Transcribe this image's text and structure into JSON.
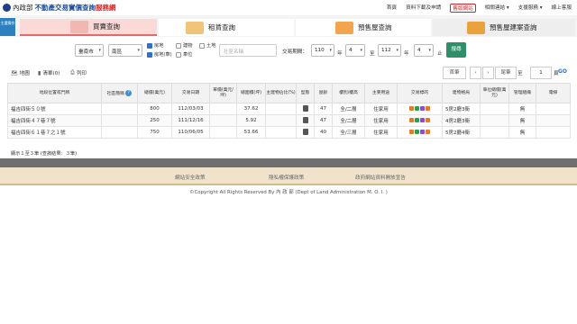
{
  "header": {
    "ministry": "內政部",
    "site_title": "不動產交易實價查詢",
    "site_title_suffix": "服務網",
    "nav": [
      "首頁",
      "資料下載及申請",
      "舊版網站",
      "相關連結 ▾",
      "支援服務 ▾",
      "線上客服"
    ]
  },
  "side_button": "主選操作",
  "tabs": [
    "買賣查詢",
    "租賃查詢",
    "預售屋查詢",
    "預售屋建案查詢"
  ],
  "filters": {
    "city": "臺南市",
    "district": "南區",
    "types": [
      {
        "label": "房地",
        "checked": true
      },
      {
        "label": "建物",
        "checked": false
      },
      {
        "label": "土地",
        "checked": false
      },
      {
        "label": "房地(車)",
        "checked": true
      },
      {
        "label": "車位",
        "checked": false
      }
    ],
    "keyword_placeholder": "社區名稱",
    "period_label": "交易期間：",
    "from_year": "110",
    "year_unit": "年",
    "from_month": "4",
    "to_label": "至",
    "to_year": "112",
    "to_month": "4",
    "until": "止",
    "search_button": "搜尋"
  },
  "toolbar": {
    "map": "地圖",
    "list": "清單(0)",
    "print": "列印",
    "first": "首筆",
    "prev": "‹",
    "next": "›",
    "last": "尾筆",
    "page_prefix": "至",
    "page_value": "1",
    "page_suffix": "頁",
    "go": "GO"
  },
  "table": {
    "headers": [
      "地段位置或門牌",
      "社區簡稱",
      "總價(萬元)",
      "交易日期",
      "單價(萬元/坪)",
      "總面積(坪)",
      "主建物佔比(%)",
      "型態",
      "屋齡",
      "樓別/樓高",
      "主要用途",
      "交易標的",
      "建物格局",
      "車位總價(萬元)",
      "管理組織",
      "電梯"
    ],
    "rows": [
      {
        "address": "福吉四街５０號",
        "community": "",
        "price": "800",
        "date": "112/03/03",
        "unit": "",
        "area": "37.62",
        "ratio": "",
        "age": "47",
        "floor": "全/二層",
        "use": "住家用",
        "layout": "5房2廳3衛",
        "parking": "",
        "mgmt": "無",
        "elev": ""
      },
      {
        "address": "福吉四街４７巷７號",
        "community": "",
        "price": "250",
        "date": "111/12/16",
        "unit": "",
        "area": "5.92",
        "ratio": "",
        "age": "47",
        "floor": "全/二層",
        "use": "住家用",
        "layout": "4房2廳3衛",
        "parking": "",
        "mgmt": "無",
        "elev": ""
      },
      {
        "address": "福吉四街６１巷７之１號",
        "community": "",
        "price": "750",
        "date": "110/06/05",
        "unit": "",
        "area": "53.66",
        "ratio": "",
        "age": "40",
        "floor": "全/三層",
        "use": "住家用",
        "layout": "5房2廳4衛",
        "parking": "",
        "mgmt": "無",
        "elev": ""
      }
    ]
  },
  "summary": "顯示１至３筆 (查詢結果：３筆)",
  "footer": {
    "links": [
      "網站安全政策",
      "隱私權保護政策",
      "政府網站資料開放宣告"
    ],
    "copyright": "©Copyright All Rights Reserved By 內 政 部 (Dept of Land Administration M. O. I. )"
  },
  "colors": {
    "accent": "#2f72c8",
    "search": "#2f8f6a",
    "address": "#a23a3a",
    "footer_bg": "#f1e3cb"
  }
}
